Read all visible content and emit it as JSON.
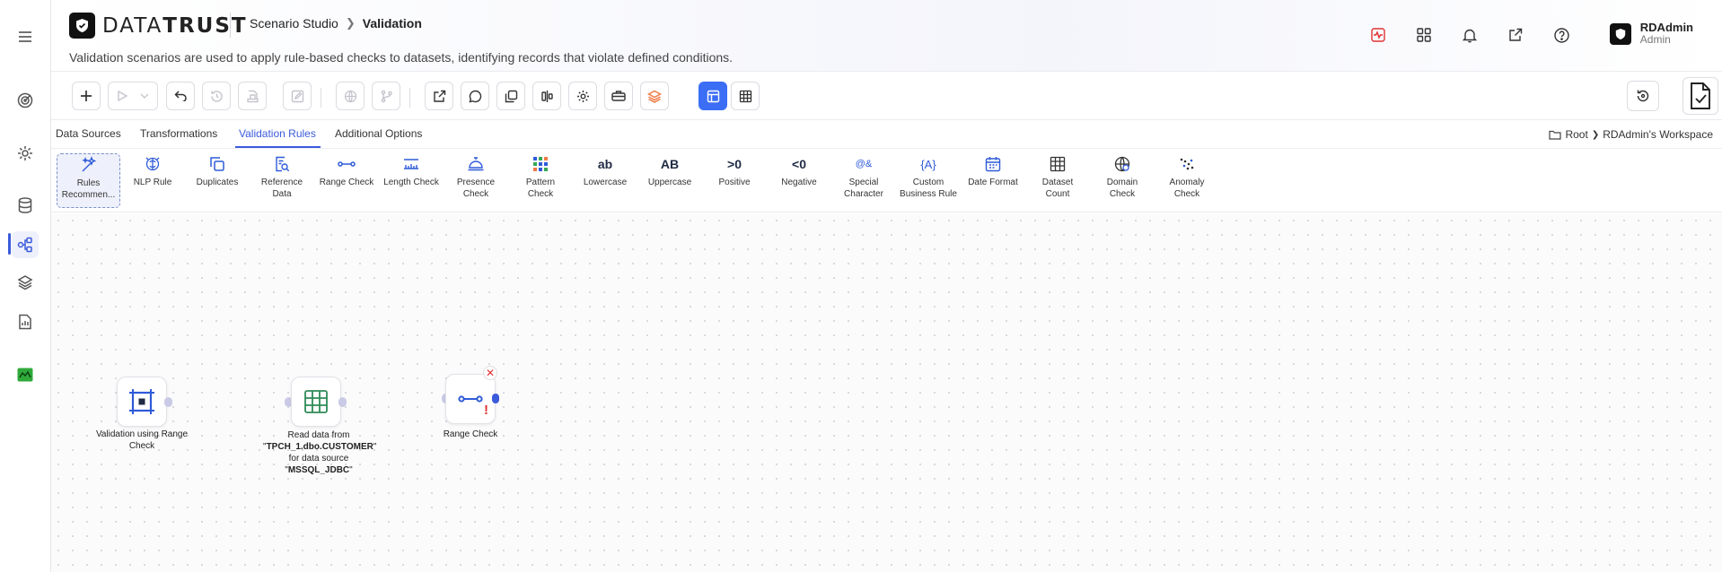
{
  "app": {
    "logo_text_light": "DATA",
    "logo_text_bold": "TRUST",
    "breadcrumb": {
      "parent": "Scenario Studio",
      "current": "Validation"
    },
    "subtitle": "Validation scenarios are used to apply rule-based checks to datasets, identifying records that violate defined conditions."
  },
  "header_icons": [
    "activity-icon",
    "apps-grid-icon",
    "bell-icon",
    "external-link-icon",
    "help-icon"
  ],
  "user": {
    "name": "RDAdmin",
    "role": "Admin"
  },
  "sidebar": {
    "items": [
      "menu-icon",
      "target-icon",
      "settings-icon",
      "database-icon",
      "workflow-icon",
      "layers-icon",
      "report-icon",
      "app-badge-icon"
    ],
    "active_index": 4
  },
  "tabs": [
    {
      "label": "Data Sources"
    },
    {
      "label": "Transformations"
    },
    {
      "label": "Validation Rules"
    },
    {
      "label": "Additional Options"
    }
  ],
  "active_tab": "Validation Rules",
  "workspace": {
    "root": "Root",
    "folder": "RDAdmin's Workspace"
  },
  "palette": [
    {
      "label": "Rules Recommen...",
      "icon": "sparkles-icon"
    },
    {
      "label": "NLP Rule",
      "icon": "brain-icon"
    },
    {
      "label": "Duplicates",
      "icon": "copy-icon"
    },
    {
      "label": "Reference Data",
      "icon": "doc-search-icon"
    },
    {
      "label": "Range Check",
      "icon": "range-icon"
    },
    {
      "label": "Length Check",
      "icon": "ruler-icon"
    },
    {
      "label": "Presence Check",
      "icon": "bell-desk-icon"
    },
    {
      "label": "Pattern Check",
      "icon": "pattern-grid-icon"
    },
    {
      "label": "Lowercase",
      "icon": "lowercase-icon",
      "glyph": "ab"
    },
    {
      "label": "Uppercase",
      "icon": "uppercase-icon",
      "glyph": "AB"
    },
    {
      "label": "Positive",
      "icon": "positive-icon",
      "glyph": ">0"
    },
    {
      "label": "Negative",
      "icon": "negative-icon",
      "glyph": "<0"
    },
    {
      "label": "Special Character",
      "icon": "special-char-icon",
      "glyph": "@&"
    },
    {
      "label": "Custom Business Rule",
      "icon": "custom-rule-icon",
      "glyph": "{A}"
    },
    {
      "label": "Date Format",
      "icon": "calendar-icon"
    },
    {
      "label": "Dataset Count",
      "icon": "table-icon"
    },
    {
      "label": "Domain Check",
      "icon": "globe-icon"
    },
    {
      "label": "Anomaly Check",
      "icon": "scatter-icon"
    }
  ],
  "flow": {
    "nodes": [
      {
        "label": "Validation using Range Check",
        "icon": "scenario-icon"
      },
      {
        "label_pre": "Read data from \"",
        "label_bold1": "TPCH_1.dbo.CUSTOMER",
        "label_mid": "\" for data source \"",
        "label_bold2": "MSSQL_JDBC",
        "label_post": "\"",
        "icon": "table-source-icon"
      },
      {
        "label": "Range Check",
        "icon": "range-icon",
        "error": "!"
      }
    ]
  },
  "colors": {
    "accent": "#3b5bdb",
    "primary_button": "#3b6ef5",
    "error": "#e03131",
    "node_icon": "#2f5bd8",
    "source_icon": "#2e8b57"
  }
}
